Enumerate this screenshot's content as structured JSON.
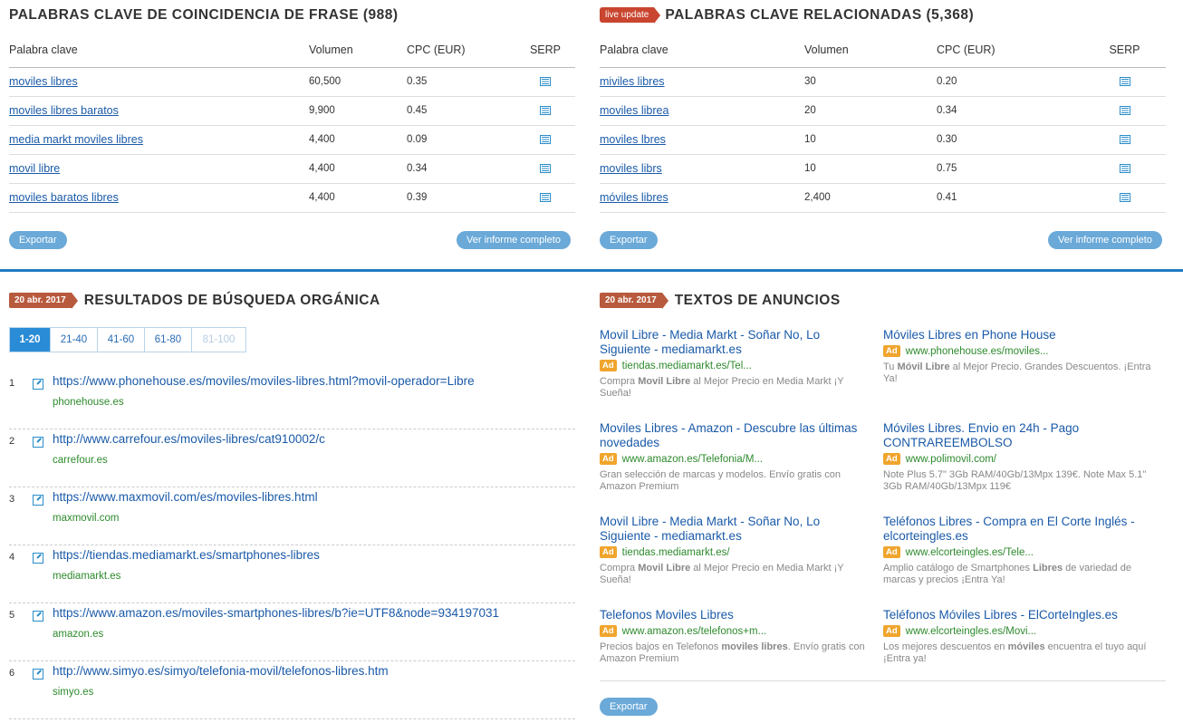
{
  "phrase_match": {
    "title": "PALABRAS CLAVE DE COINCIDENCIA DE FRASE (988)",
    "columns": [
      "Palabra clave",
      "Volumen",
      "CPC (EUR)",
      "SERP"
    ],
    "rows": [
      {
        "keyword": "moviles libres",
        "volume": "60,500",
        "cpc": "0.35"
      },
      {
        "keyword": "moviles libres baratos",
        "volume": "9,900",
        "cpc": "0.45"
      },
      {
        "keyword": "media markt moviles libres",
        "volume": "4,400",
        "cpc": "0.09"
      },
      {
        "keyword": "movil libre",
        "volume": "4,400",
        "cpc": "0.34"
      },
      {
        "keyword": "moviles baratos libres",
        "volume": "4,400",
        "cpc": "0.39"
      }
    ],
    "export_label": "Exportar",
    "full_report_label": "Ver informe completo"
  },
  "related": {
    "badge": "live update",
    "title": "PALABRAS CLAVE RELACIONADAS (5,368)",
    "columns": [
      "Palabra clave",
      "Volumen",
      "CPC (EUR)",
      "SERP"
    ],
    "rows": [
      {
        "keyword": "miviles libres",
        "volume": "30",
        "cpc": "0.20"
      },
      {
        "keyword": "moviles librea",
        "volume": "20",
        "cpc": "0.34"
      },
      {
        "keyword": "moviles lbres",
        "volume": "10",
        "cpc": "0.30"
      },
      {
        "keyword": "moviles librs",
        "volume": "10",
        "cpc": "0.75"
      },
      {
        "keyword": "móviles libres",
        "volume": "2,400",
        "cpc": "0.41"
      }
    ],
    "export_label": "Exportar",
    "full_report_label": "Ver informe completo"
  },
  "organic": {
    "date_badge": "20 abr. 2017",
    "title": "RESULTADOS DE BÚSQUEDA ORGÁNICA",
    "pages": [
      "1-20",
      "21-40",
      "41-60",
      "61-80",
      "81-100"
    ],
    "results": [
      {
        "n": "1",
        "url": "https://www.phonehouse.es/moviles/moviles-libres.html?movil-operador=Libre",
        "domain": "phonehouse.es"
      },
      {
        "n": "2",
        "url": "http://www.carrefour.es/moviles-libres/cat910002/c",
        "domain": "carrefour.es"
      },
      {
        "n": "3",
        "url": "https://www.maxmovil.com/es/moviles-libres.html",
        "domain": "maxmovil.com"
      },
      {
        "n": "4",
        "url": "https://tiendas.mediamarkt.es/smartphones-libres",
        "domain": "mediamarkt.es"
      },
      {
        "n": "5",
        "url": "https://www.amazon.es/moviles-smartphones-libres/b?ie=UTF8&node=934197031",
        "domain": "amazon.es"
      },
      {
        "n": "6",
        "url": "http://www.simyo.es/simyo/telefonia-movil/telefonos-libres.htm",
        "domain": "simyo.es"
      }
    ]
  },
  "ads": {
    "date_badge": "20 abr. 2017",
    "title": "TEXTOS DE ANUNCIOS",
    "ad_tag": "Ad",
    "export_label": "Exportar",
    "items": [
      {
        "title": "Movil Libre - Media Markt - Soñar No, Lo Siguiente - mediamarkt.es",
        "url": "tiendas.mediamarkt.es/Tel...",
        "desc_pre": "Compra ",
        "desc_bold": "Movil Libre",
        "desc_post": " al Mejor Precio en Media Markt ¡Y Sueña!"
      },
      {
        "title": "Móviles Libres en Phone House",
        "url": "www.phonehouse.es/moviles...",
        "desc_pre": "Tu ",
        "desc_bold": "Móvil Libre",
        "desc_post": " al Mejor Precio. Grandes Descuentos. ¡Entra Ya!"
      },
      {
        "title": "Moviles Libres - Amazon - Descubre las últimas novedades",
        "url": "www.amazon.es/Telefonia/M...",
        "desc_pre": "Gran selección de marcas y modelos. Envío gratis con Amazon Premium",
        "desc_bold": "",
        "desc_post": ""
      },
      {
        "title": "Móviles Libres. Envio en 24h - Pago CONTRAREEMBOLSO",
        "url": "www.polimovil.com/",
        "desc_pre": "Note Plus 5.7\" 3Gb RAM/40Gb/13Mpx 139€. Note Max 5.1\" 3Gb RAM/40Gb/13Mpx 119€",
        "desc_bold": "",
        "desc_post": ""
      },
      {
        "title": "Movil Libre - Media Markt - Soñar No, Lo Siguiente - mediamarkt.es",
        "url": "tiendas.mediamarkt.es/",
        "desc_pre": "Compra ",
        "desc_bold": "Movil Libre",
        "desc_post": " al Mejor Precio en Media Markt ¡Y Sueña!"
      },
      {
        "title": "Teléfonos Libres - Compra en El Corte Inglés - elcorteingles.es",
        "url": "www.elcorteingles.es/Tele...",
        "desc_pre": "Amplio catálogo de Smartphones ",
        "desc_bold": "Libres",
        "desc_post": " de variedad de marcas y precios ¡Entra Ya!"
      },
      {
        "title": "Telefonos Moviles Libres",
        "url": "www.amazon.es/telefonos+m...",
        "desc_pre": "Precios bajos en Telefonos ",
        "desc_bold": "moviles libres",
        "desc_post": ". Envío gratis con Amazon Premium"
      },
      {
        "title": "Teléfonos Móviles Libres - ElCorteIngles.es",
        "url": "www.elcorteingles.es/Movi...",
        "desc_pre": "Los mejores descuentos en ",
        "desc_bold": "móviles",
        "desc_post": " encuentra el tuyo aquí ¡Entra ya!"
      }
    ]
  },
  "colors": {
    "link": "#1a5aa8",
    "accent_blue": "#1f7dc4",
    "pill_blue": "#6aa9d8",
    "domain_green": "#2d8a2d",
    "badge_red": "#c9452f",
    "ad_tag_orange": "#f0a52d"
  }
}
